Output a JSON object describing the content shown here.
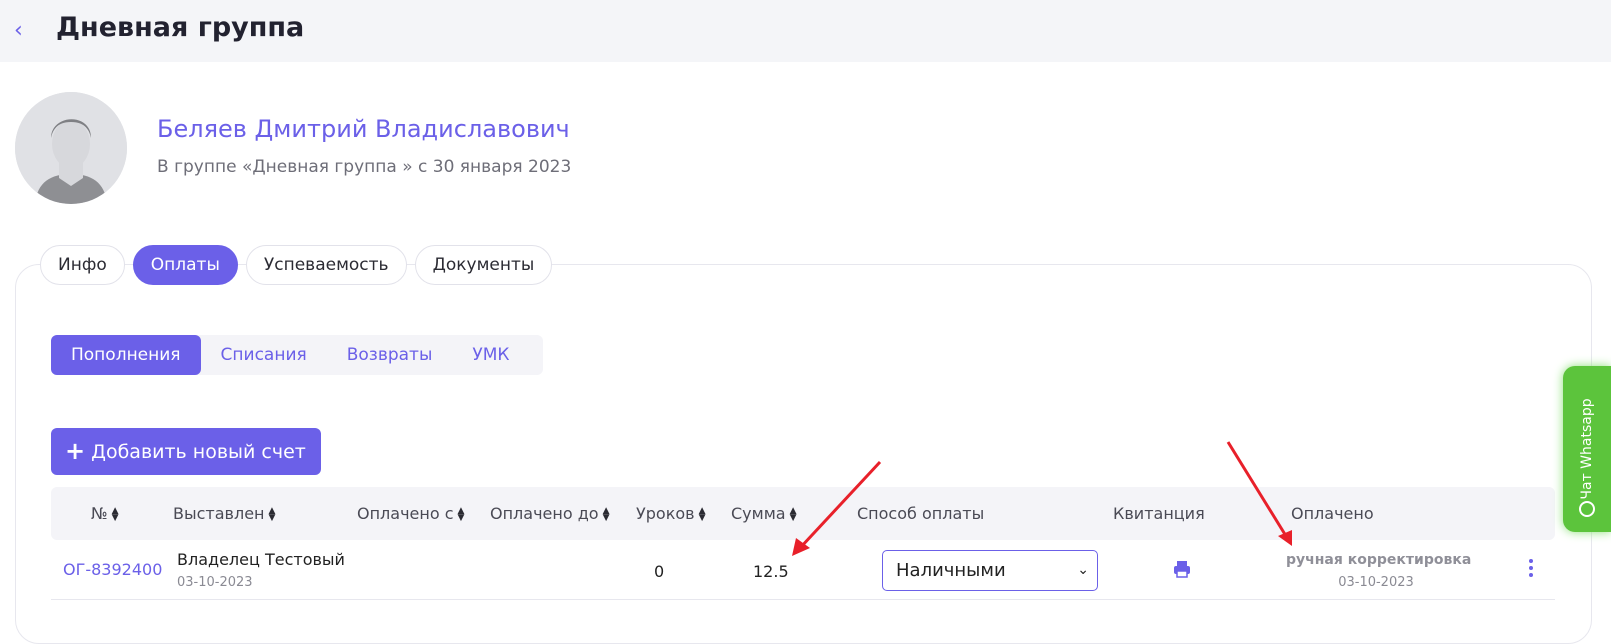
{
  "header": {
    "back_icon": "chevron-left-icon",
    "title": "Дневная группа"
  },
  "student": {
    "name": "Беляев Дмитрий Владиславович",
    "subtitle": "В группе «Дневная группа » с 30 января 2023"
  },
  "tabs": [
    {
      "label": "Инфо",
      "active": false
    },
    {
      "label": "Оплаты",
      "active": true
    },
    {
      "label": "Успеваемость",
      "active": false
    },
    {
      "label": "Документы",
      "active": false
    }
  ],
  "subtabs": [
    {
      "label": "Пополнения",
      "active": true
    },
    {
      "label": "Списания",
      "active": false
    },
    {
      "label": "Возвраты",
      "active": false
    },
    {
      "label": "УМК",
      "active": false
    }
  ],
  "add_button": {
    "label": "Добавить новый счет"
  },
  "table": {
    "columns": [
      "№",
      "Выставлен",
      "Оплачено с",
      "Оплачено до",
      "Уроков",
      "Сумма",
      "Способ оплаты",
      "Квитанция",
      "Оплачено"
    ],
    "rows": [
      {
        "number": "ОГ-8392400",
        "issued_by": "Владелец Тестовый",
        "issued_date": "03-10-2023",
        "paid_from": "",
        "paid_to": "",
        "lessons": "0",
        "sum": "12.5",
        "payment_method": "Наличными",
        "paid_status": "ручная корректировка",
        "paid_date": "03-10-2023"
      }
    ]
  },
  "whatsapp": {
    "label": "Чат Whatsapp"
  },
  "colors": {
    "accent": "#6b60e8",
    "whatsapp": "#5cc43c",
    "annotation": "#e8202a"
  }
}
